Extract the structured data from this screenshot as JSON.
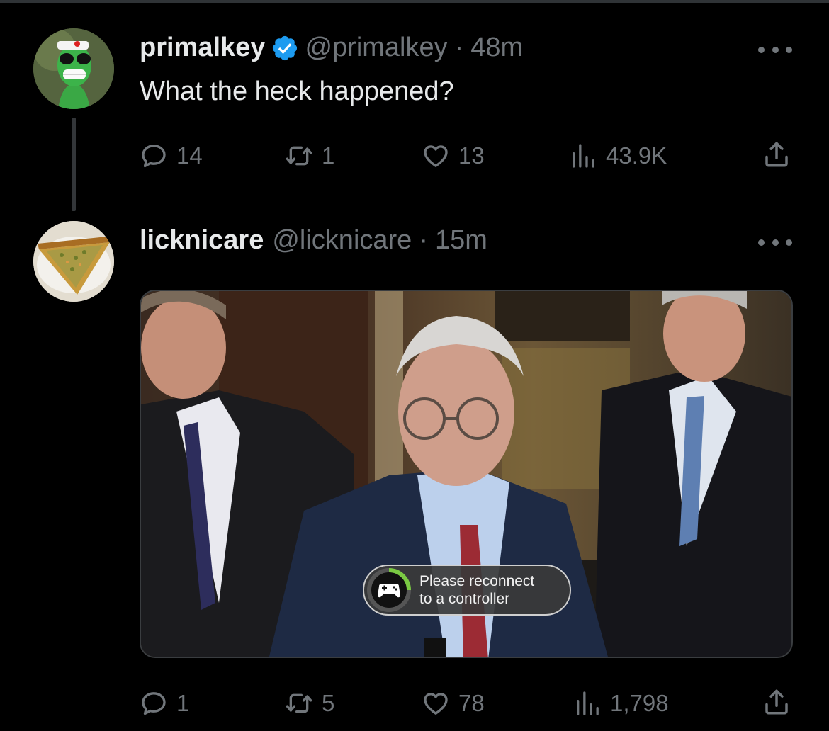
{
  "tweets": [
    {
      "name": "primalkey",
      "handle": "@primalkey",
      "separator": "·",
      "time": "48m",
      "verified": true,
      "text": "What the heck happened?",
      "stats": {
        "replies": "14",
        "reposts": "1",
        "likes": "13",
        "views": "43.9K"
      }
    },
    {
      "name": "licknicare",
      "handle": "@licknicare",
      "separator": "·",
      "time": "15m",
      "verified": false,
      "media": {
        "overlay_line1": "Please reconnect",
        "overlay_line2": "to a controller"
      },
      "stats": {
        "replies": "1",
        "reposts": "5",
        "likes": "78",
        "views": "1,798"
      }
    }
  ],
  "colors": {
    "background": "#000000",
    "muted": "#71767b",
    "text": "#e7e9ea",
    "verified_blue": "#1d9bf0"
  },
  "icons": [
    "reply-icon",
    "repost-icon",
    "like-icon",
    "views-icon",
    "share-icon",
    "verified-badge-icon",
    "more-icon",
    "controller-icon"
  ]
}
